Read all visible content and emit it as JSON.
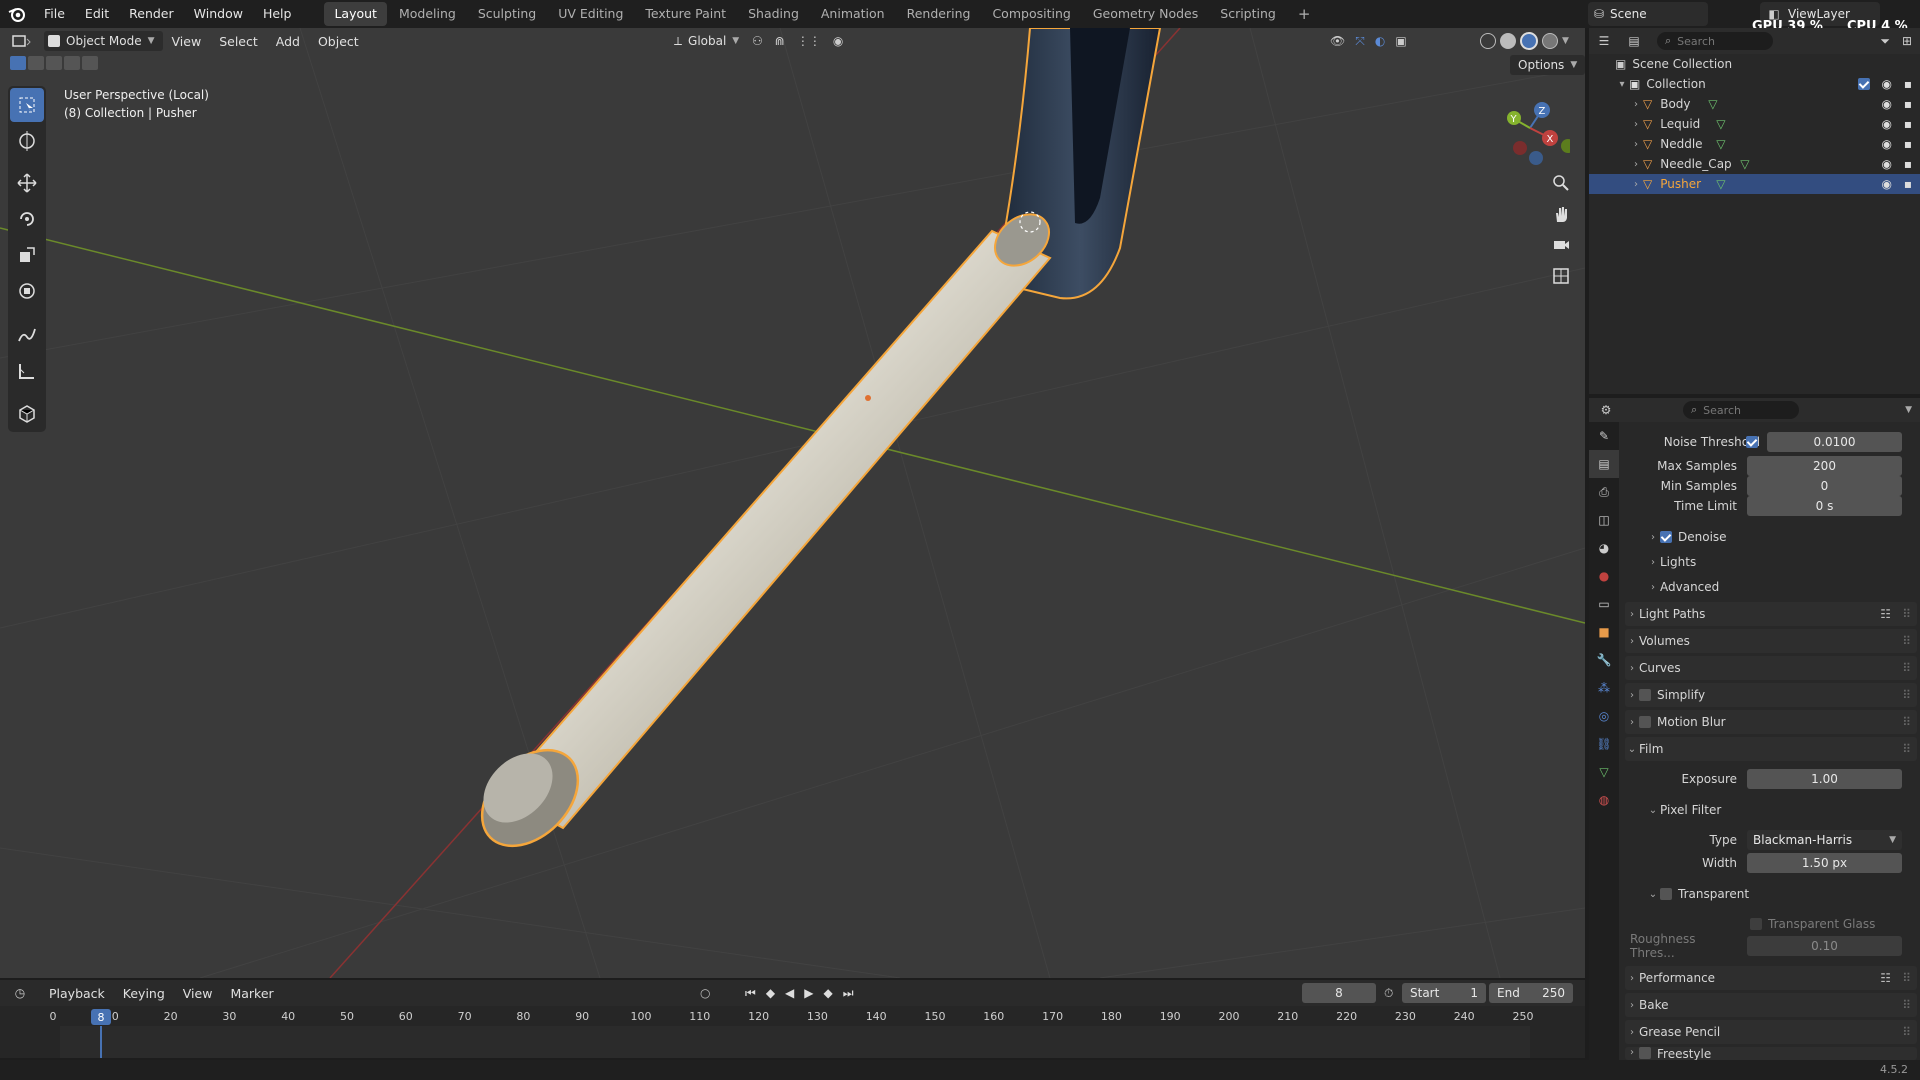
{
  "menu": {
    "items": [
      "File",
      "Edit",
      "Render",
      "Window",
      "Help"
    ]
  },
  "workspaces": [
    "Layout",
    "Modeling",
    "Sculpting",
    "UV Editing",
    "Texture Paint",
    "Shading",
    "Animation",
    "Rendering",
    "Compositing",
    "Geometry Nodes",
    "Scripting"
  ],
  "active_workspace": "Layout",
  "topright": {
    "scene": "Scene",
    "viewlayer": "ViewLayer",
    "gpu_label": "GPU",
    "gpu_value": "39 %",
    "cpu_label": "CPU",
    "cpu_value": "4 %"
  },
  "viewport_header": {
    "mode": "Object Mode",
    "menus": [
      "View",
      "Select",
      "Add",
      "Object"
    ],
    "orientation": "Global",
    "options": "Options"
  },
  "viewport": {
    "perspective": "User Perspective (Local)",
    "context": "(8) Collection | Pusher"
  },
  "outliner": {
    "search_placeholder": "Search",
    "scene_collection": "Scene Collection",
    "collection": "Collection",
    "objects": [
      "Body",
      "Lequid",
      "Neddle",
      "Needle_Cap",
      "Pusher"
    ],
    "selected": "Pusher"
  },
  "props": {
    "search_placeholder": "Search",
    "noise_threshold": {
      "label": "Noise Threshold",
      "value": "0.0100"
    },
    "max_samples": {
      "label": "Max Samples",
      "value": "200"
    },
    "min_samples": {
      "label": "Min Samples",
      "value": "0"
    },
    "time_limit": {
      "label": "Time Limit",
      "value": "0 s"
    },
    "denoise": "Denoise",
    "lights": "Lights",
    "advanced": "Advanced",
    "light_paths": "Light Paths",
    "volumes": "Volumes",
    "curves": "Curves",
    "simplify": "Simplify",
    "motion_blur": "Motion Blur",
    "film": "Film",
    "exposure": {
      "label": "Exposure",
      "value": "1.00"
    },
    "pixel_filter": "Pixel Filter",
    "type": {
      "label": "Type",
      "value": "Blackman-Harris"
    },
    "width": {
      "label": "Width",
      "value": "1.50 px"
    },
    "transparent": "Transparent",
    "transparent_glass": "Transparent Glass",
    "roughness": {
      "label": "Roughness Thres...",
      "value": "0.10"
    },
    "performance": "Performance",
    "bake": "Bake",
    "grease_pencil": "Grease Pencil",
    "freestyle": "Freestyle"
  },
  "timeline": {
    "menus": [
      "Playback",
      "Keying",
      "View",
      "Marker"
    ],
    "current_frame": "8",
    "start_label": "Start",
    "start": "1",
    "end_label": "End",
    "end": "250",
    "ticks": [
      "0",
      "10",
      "20",
      "30",
      "40",
      "50",
      "60",
      "70",
      "80",
      "90",
      "100",
      "110",
      "120",
      "130",
      "140",
      "150",
      "160",
      "170",
      "180",
      "190",
      "200",
      "210",
      "220",
      "230",
      "240",
      "250"
    ],
    "playhead": "8"
  },
  "version": "4.5.2",
  "colors": {
    "accent": "#4772b3",
    "selection": "#f5a63b",
    "x_axis": "#c0423f",
    "y_axis": "#85b32e"
  }
}
